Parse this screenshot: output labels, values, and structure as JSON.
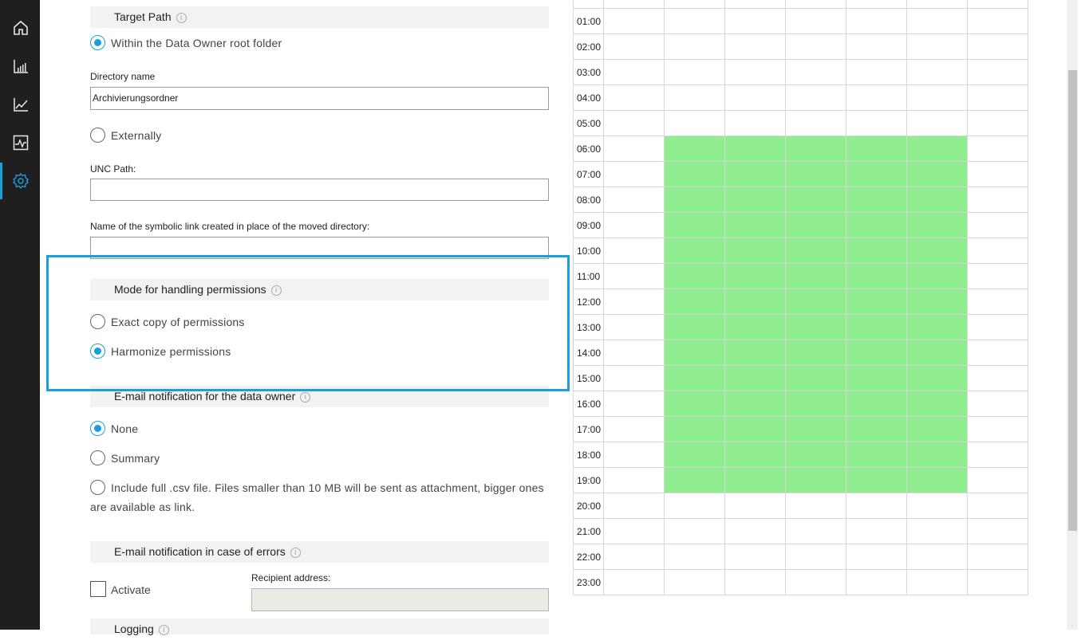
{
  "nav": {
    "items": [
      {
        "name": "home",
        "icon": "home-icon"
      },
      {
        "name": "reports",
        "icon": "bar-chart-icon"
      },
      {
        "name": "analytics",
        "icon": "line-chart-icon"
      },
      {
        "name": "monitor",
        "icon": "activity-icon"
      },
      {
        "name": "settings",
        "icon": "gear-icon",
        "active": true
      }
    ],
    "active_color": "#1a9fd9"
  },
  "target_path": {
    "header": "Target Path",
    "within_root_label": "Within the Data Owner root folder",
    "within_root_checked": true,
    "directory_name_label": "Directory name",
    "directory_name_value": "Archivierungsordner",
    "externally_label": "Externally",
    "externally_checked": false,
    "unc_path_label": "UNC Path:",
    "unc_path_value": "",
    "symlink_label": "Name of the symbolic link created in place of the moved directory:",
    "symlink_value": ""
  },
  "permissions": {
    "header": "Mode for handling permissions",
    "exact_copy_label": "Exact copy of permissions",
    "exact_copy_checked": false,
    "harmonize_label": "Harmonize permissions",
    "harmonize_checked": true
  },
  "email_owner": {
    "header": "E-mail notification for the data owner",
    "none_label": "None",
    "none_checked": true,
    "summary_label": "Summary",
    "summary_checked": false,
    "full_csv_label_line1": "Include full .csv file. Files smaller than 10 MB will be sent as attachment, bigger ones",
    "full_csv_label_line2": "are available as link.",
    "full_csv_checked": false
  },
  "email_errors": {
    "header": "E-mail notification in case of errors",
    "activate_label": "Activate",
    "activate_checked": false,
    "recipient_label": "Recipient address:",
    "recipient_value": ""
  },
  "logging": {
    "header": "Logging"
  },
  "schedule": {
    "hours": [
      "01:00",
      "02:00",
      "03:00",
      "04:00",
      "05:00",
      "06:00",
      "07:00",
      "08:00",
      "09:00",
      "10:00",
      "11:00",
      "12:00",
      "13:00",
      "14:00",
      "15:00",
      "16:00",
      "17:00",
      "18:00",
      "19:00",
      "20:00",
      "21:00",
      "22:00",
      "23:00"
    ],
    "active_hours": [
      "06:00",
      "07:00",
      "08:00",
      "09:00",
      "10:00",
      "11:00",
      "12:00",
      "13:00",
      "14:00",
      "15:00",
      "16:00",
      "17:00",
      "18:00",
      "19:00"
    ],
    "day_columns": 7,
    "active_day_columns": [
      1,
      2,
      3,
      4,
      5
    ],
    "active_color": "#90ee90"
  }
}
